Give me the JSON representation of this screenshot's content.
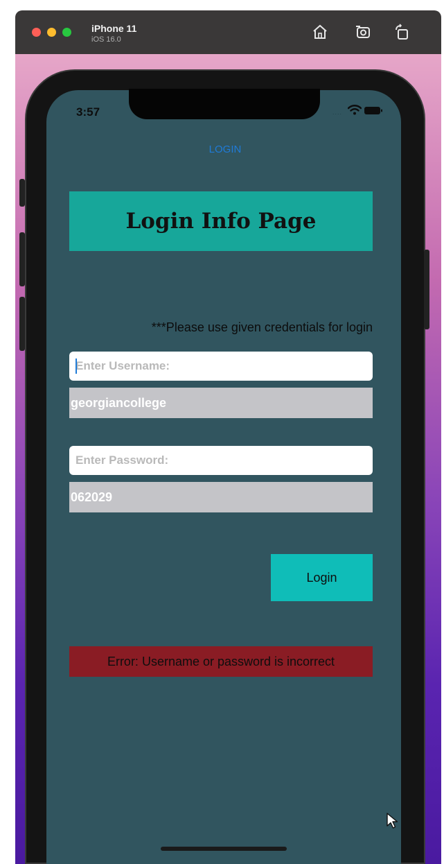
{
  "window": {
    "device_name": "iPhone 11",
    "os_version": "iOS 16.0",
    "toolbar_icons": [
      "home-icon",
      "screenshot-icon",
      "rotate-icon"
    ]
  },
  "status_bar": {
    "time": "3:57",
    "signal": "....",
    "icons": [
      "wifi-icon",
      "battery-icon"
    ]
  },
  "nav": {
    "title": "LOGIN"
  },
  "header": {
    "title": "Login Info Page"
  },
  "notice": "***Please use given credentials for login",
  "username": {
    "placeholder": "Enter Username:",
    "hint_value": "georgiancollege"
  },
  "password": {
    "placeholder": "Enter Password:",
    "hint_value": "062029"
  },
  "login_button": {
    "label": "Login"
  },
  "error": {
    "message": "Error: Username or password is incorrect"
  },
  "colors": {
    "screen_bg": "#31555f",
    "header_bg": "#17a79a",
    "button_bg": "#0fbdb8",
    "error_bg": "#8a1c24",
    "hint_bg": "#c4c4c8",
    "nav_title": "#1f7bd8"
  }
}
